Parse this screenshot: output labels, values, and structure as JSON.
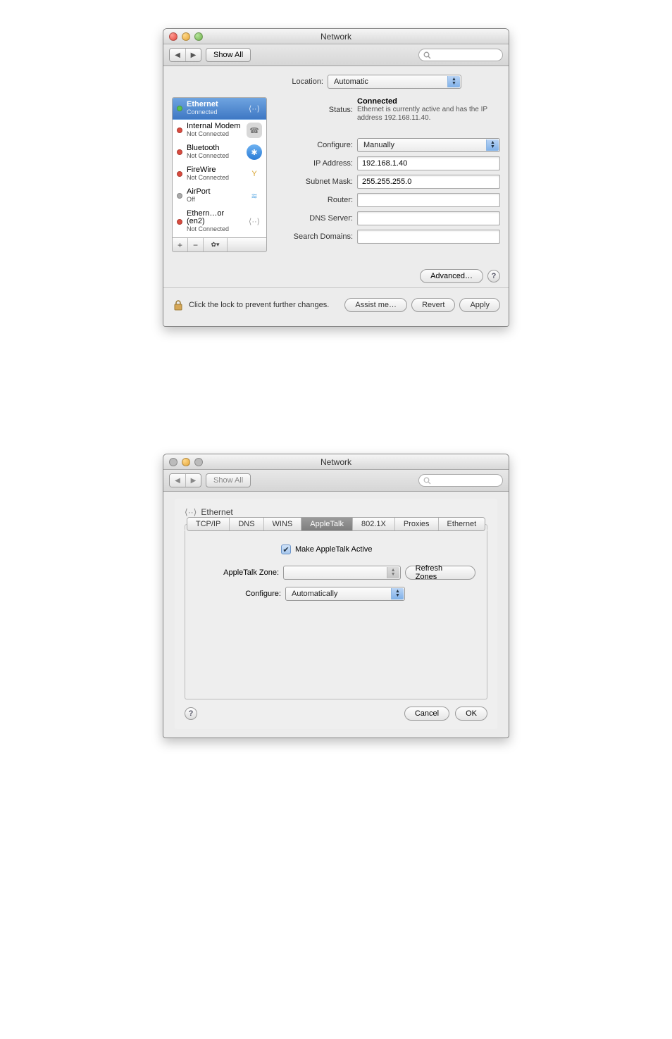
{
  "window1": {
    "title": "Network",
    "showall_label": "Show All",
    "location_label": "Location:",
    "location_value": "Automatic",
    "services": [
      {
        "name": "Ethernet",
        "sub": "Connected",
        "status": "green",
        "icon": "eth-sel",
        "glyph": "⟨··⟩",
        "selected": true
      },
      {
        "name": "Internal Modem",
        "sub": "Not Connected",
        "status": "red",
        "icon": "modem",
        "glyph": "☎"
      },
      {
        "name": "Bluetooth",
        "sub": "Not Connected",
        "status": "red",
        "icon": "bt",
        "glyph": "✱"
      },
      {
        "name": "FireWire",
        "sub": "Not Connected",
        "status": "red",
        "icon": "fw",
        "glyph": "Y"
      },
      {
        "name": "AirPort",
        "sub": "Off",
        "status": "gray",
        "icon": "wifi",
        "glyph": "≋"
      },
      {
        "name": "Ethern…or (en2)",
        "sub": "Not Connected",
        "status": "red",
        "icon": "eth2",
        "glyph": "⟨··⟩"
      }
    ],
    "gear_glyph": "✿▾",
    "plus": "+",
    "minus": "−",
    "status_label": "Status:",
    "status_value": "Connected",
    "status_desc": "Ethernet is currently active and has the IP address 192.168.11.40.",
    "fields": {
      "configure_label": "Configure:",
      "configure_value": "Manually",
      "ip_label": "IP Address:",
      "ip_value": "192.168.1.40",
      "subnet_label": "Subnet Mask:",
      "subnet_value": "255.255.255.0",
      "router_label": "Router:",
      "router_value": "",
      "dns_label": "DNS Server:",
      "dns_value": "",
      "search_label": "Search Domains:",
      "search_value": ""
    },
    "advanced_label": "Advanced…",
    "lock_text": "Click the lock to prevent further changes.",
    "assist_label": "Assist me…",
    "revert_label": "Revert",
    "apply_label": "Apply"
  },
  "window2": {
    "title": "Network",
    "showall_label": "Show All",
    "header_iface": "Ethernet",
    "tabs": {
      "tcpip": "TCP/IP",
      "dns": "DNS",
      "wins": "WINS",
      "appletalk": "AppleTalk",
      "x": "802.1X",
      "proxies": "Proxies",
      "ethernet": "Ethernet"
    },
    "make_active_label": "Make AppleTalk Active",
    "zone_label": "AppleTalk Zone:",
    "zone_value": "",
    "refresh_label": "Refresh Zones",
    "configure_label": "Configure:",
    "configure_value": "Automatically",
    "cancel_label": "Cancel",
    "ok_label": "OK"
  }
}
